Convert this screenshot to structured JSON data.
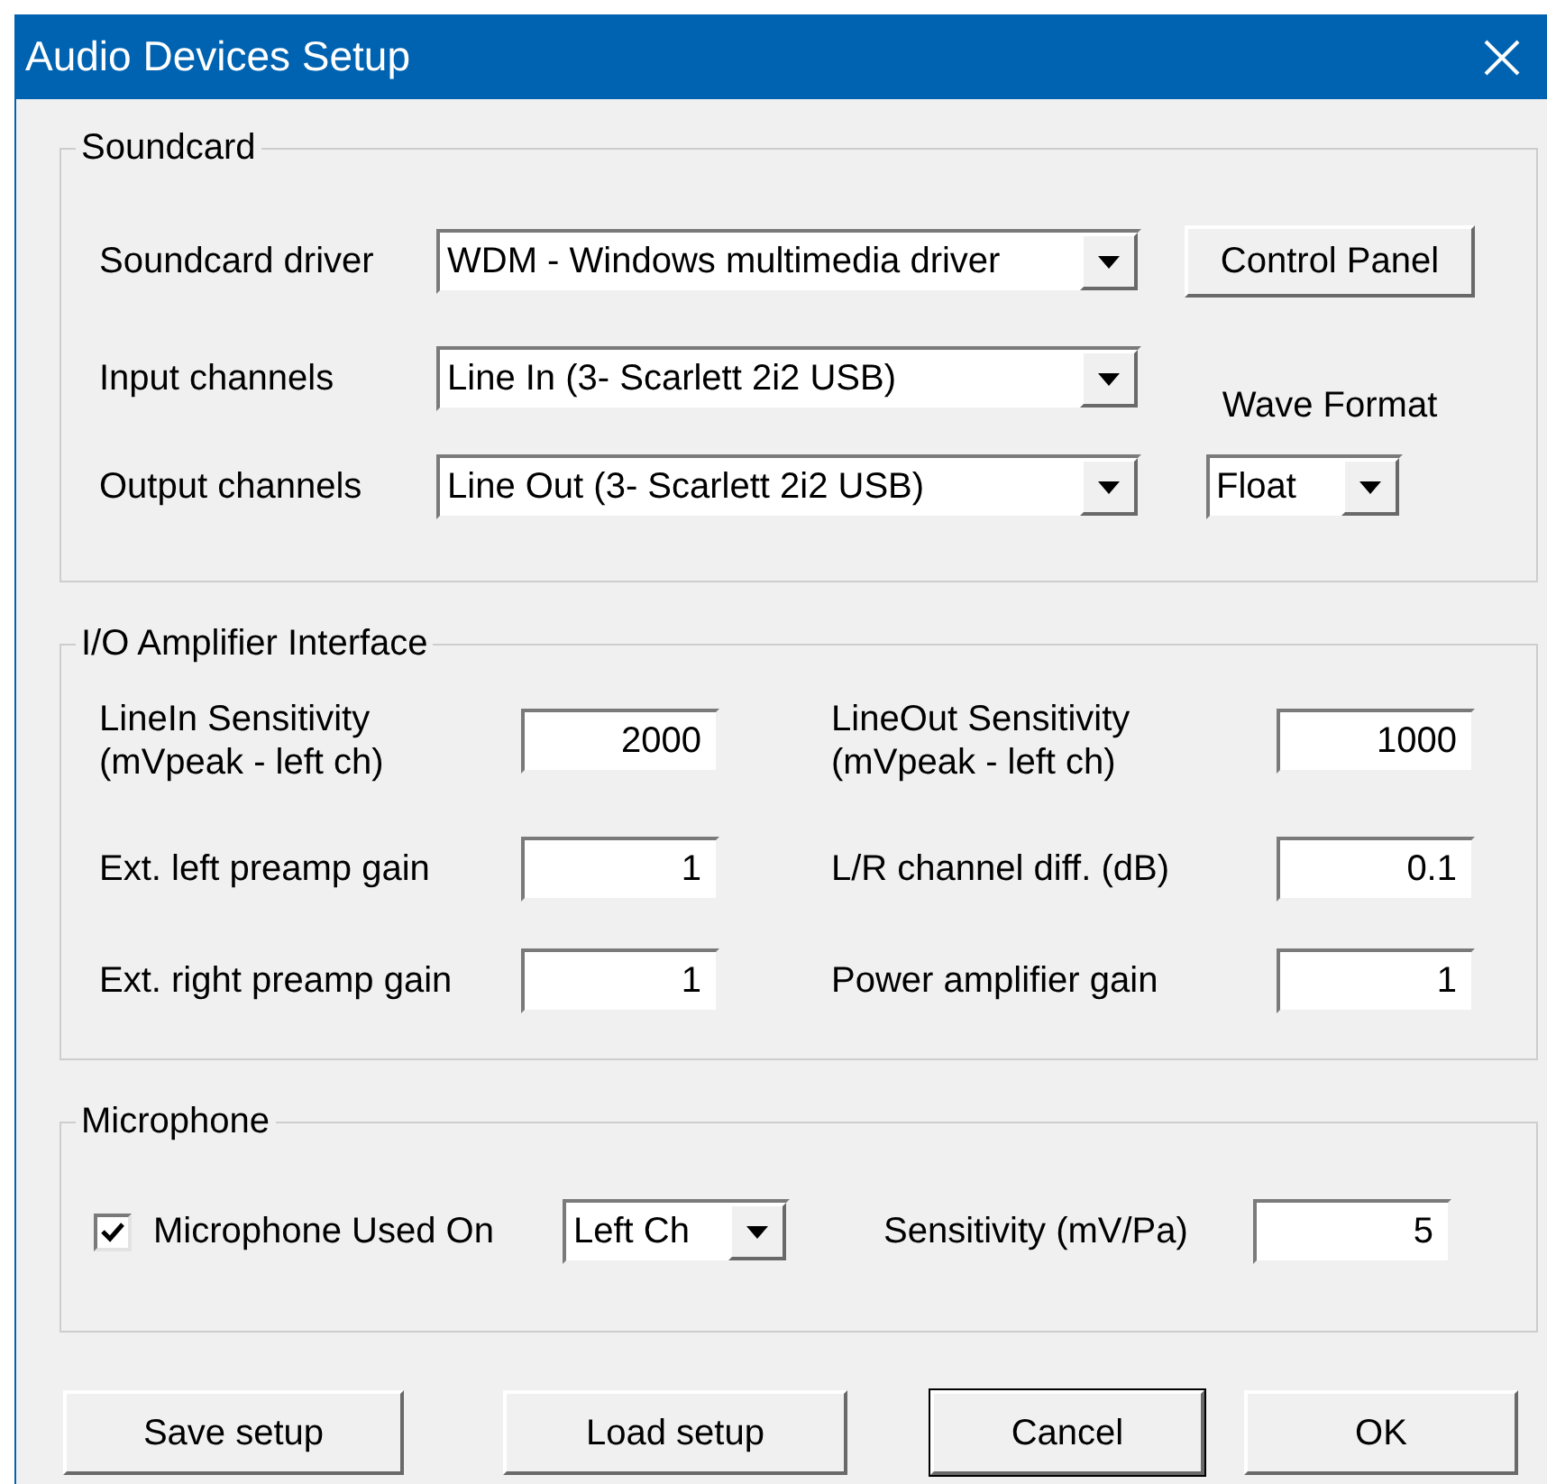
{
  "window": {
    "title": "Audio Devices Setup"
  },
  "soundcard": {
    "title": "Soundcard",
    "fields": [
      {
        "label": "Soundcard driver",
        "value": "WDM - Windows multimedia driver"
      },
      {
        "label": "Input channels",
        "value": "Line In (3- Scarlett 2i2 USB)"
      },
      {
        "label": "Output channels",
        "value": "Line Out (3- Scarlett 2i2 USB)"
      }
    ],
    "control_panel": "Control Panel",
    "wave_format": {
      "label": "Wave Format",
      "value": "Float"
    }
  },
  "io_amplifier": {
    "title": "I/O Amplifier Interface",
    "fields": [
      {
        "label": "LineIn Sensitivity\n(mVpeak - left ch)",
        "value": "2000"
      },
      {
        "label": "LineOut Sensitivity\n(mVpeak - left ch)",
        "value": "1000"
      },
      {
        "label": "Ext. left preamp gain",
        "value": "1"
      },
      {
        "label": "L/R channel diff. (dB)",
        "value": "0.1"
      },
      {
        "label": "Ext. right preamp gain",
        "value": "1"
      },
      {
        "label": "Power amplifier gain",
        "value": "1"
      }
    ]
  },
  "microphone": {
    "title": "Microphone",
    "checked": true,
    "label": "Microphone Used On",
    "channel": "Left Ch",
    "sensitivity_label": "Sensitivity (mV/Pa)",
    "sensitivity": "5"
  },
  "buttons": [
    {
      "label": "Save setup",
      "default": false
    },
    {
      "label": "Load setup",
      "default": false
    },
    {
      "label": "Cancel",
      "default": true
    },
    {
      "label": "OK",
      "default": false
    }
  ]
}
